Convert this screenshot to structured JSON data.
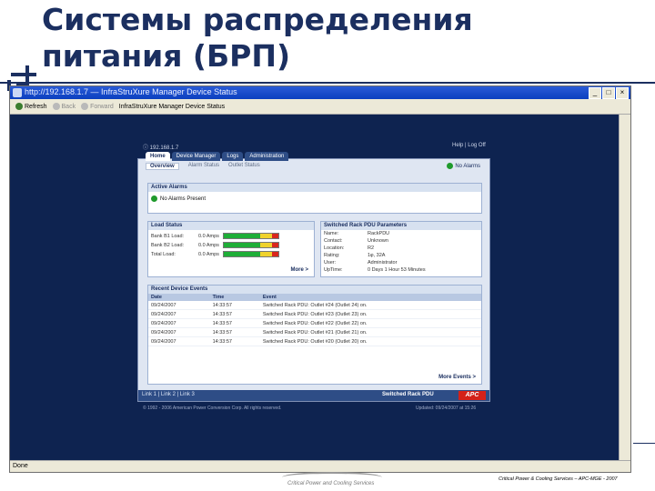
{
  "slide": {
    "title_line1": "Системы распределения",
    "title_line2": "питания (БРП)",
    "footer_right": "Critical Power & Cooling Services – APC-MGE - 2007",
    "footer_left": "Critical Power and Cooling Services"
  },
  "browser": {
    "window_title": "http://192.168.1.7 — InfraStruXure Manager Device Status",
    "toolbar": [
      {
        "label": "Refresh",
        "enabled": true
      },
      {
        "label": "Back",
        "enabled": false
      },
      {
        "label": "Forward",
        "enabled": false
      },
      {
        "label": "InfraStruXure Manager Device Status",
        "enabled": true
      }
    ],
    "status_text": "Done"
  },
  "app": {
    "ip": "192.168.1.7",
    "help_logoff": "Help | Log Off",
    "tabs": [
      "Home",
      "Device Manager",
      "Logs",
      "Administration"
    ],
    "subtabs": [
      "Overview",
      "Alarm Status",
      "Outlet Status"
    ],
    "status_badge": "No Alarms",
    "active_alarms": {
      "title": "Active Alarms",
      "message": "No Alarms Present"
    },
    "load_status": {
      "title": "Load Status",
      "rows": [
        {
          "label": "Bank B1 Load:",
          "value": "0.0 Amps"
        },
        {
          "label": "Bank B2 Load:",
          "value": "0.0 Amps"
        },
        {
          "label": "Total Load:",
          "value": "0.0 Amps"
        }
      ],
      "more": "More >"
    },
    "parameters": {
      "title": "Switched Rack PDU Parameters",
      "rows": [
        {
          "k": "Name:",
          "v": "RackPDU"
        },
        {
          "k": "Contact:",
          "v": "Unknown"
        },
        {
          "k": "Location:",
          "v": "R2"
        },
        {
          "k": "Rating:",
          "v": "1φ, 32A"
        },
        {
          "k": "User:",
          "v": "Administrator"
        },
        {
          "k": "UpTime:",
          "v": "0 Days 1 Hour 53 Minutes"
        }
      ]
    },
    "events": {
      "title": "Recent Device Events",
      "columns": [
        "Date",
        "Time",
        "Event"
      ],
      "rows": [
        [
          "09/24/2007",
          "14:33:57",
          "Switched Rack PDU: Outlet #24 (Outlet 24) on."
        ],
        [
          "09/24/2007",
          "14:33:57",
          "Switched Rack PDU: Outlet #23 (Outlet 23) on."
        ],
        [
          "09/24/2007",
          "14:33:57",
          "Switched Rack PDU: Outlet #22 (Outlet 22) on."
        ],
        [
          "09/24/2007",
          "14:33:57",
          "Switched Rack PDU: Outlet #21 (Outlet 21) on."
        ],
        [
          "09/24/2007",
          "14:33:57",
          "Switched Rack PDU: Outlet #20 (Outlet 20) on."
        ]
      ],
      "more": "More Events >"
    },
    "footer": {
      "links": "Link 1 | Link 2 | Link 3",
      "product": "Switched Rack PDU",
      "brand": "APC"
    },
    "copyright": "© 1992 - 2006 American Power Conversion Corp. All rights reserved.",
    "updated": "Updated: 09/24/2007 at 15:26"
  },
  "colors": {
    "title": "#1b2f60",
    "page_bg": "#0e2350",
    "panel_bg": "#dfe6f2",
    "brand_red": "#d42119",
    "ok_green": "#1f9a2c"
  }
}
